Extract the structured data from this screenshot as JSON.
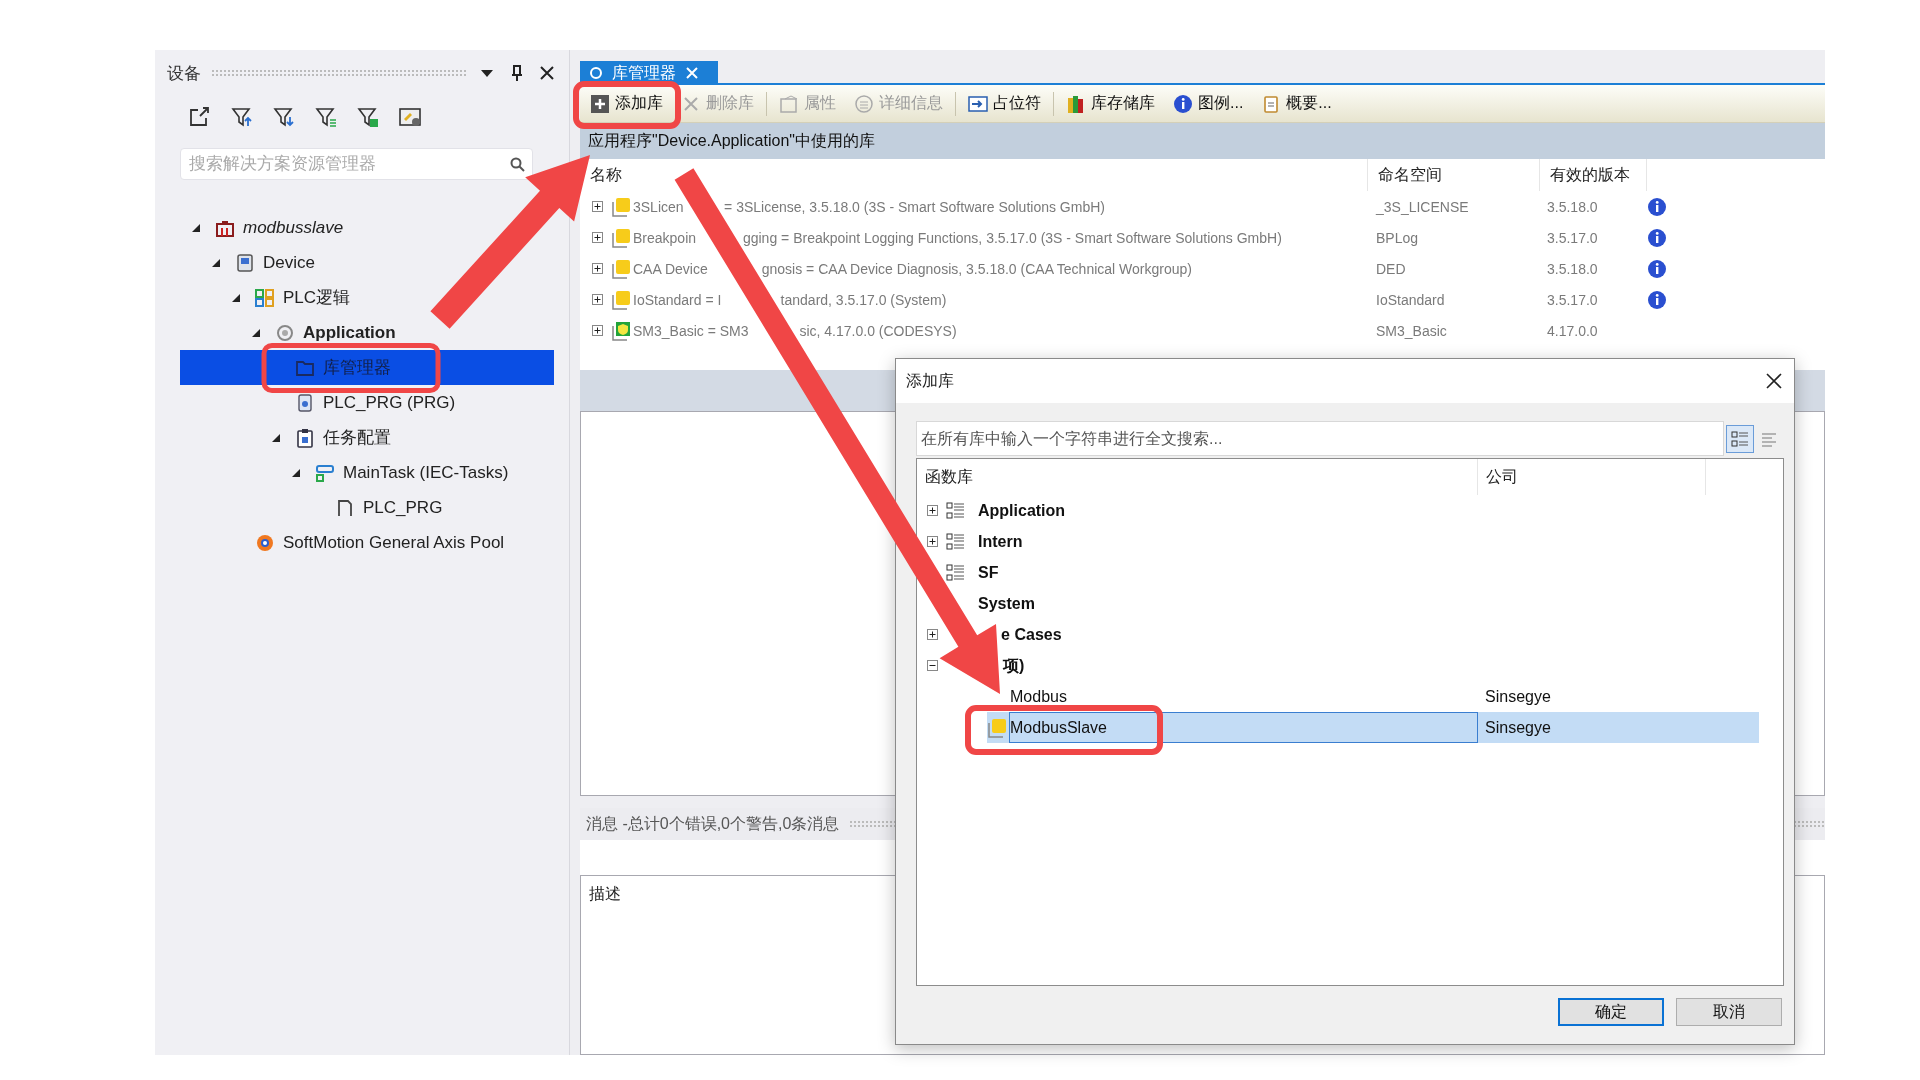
{
  "devices_panel": {
    "title": "设备",
    "search": {
      "placeholder": "搜索解决方案资源管理器"
    },
    "tree": [
      {
        "label": "modbusslave",
        "kind": "project",
        "expanded": true,
        "selected": false,
        "children": [
          {
            "label": "Device",
            "kind": "device",
            "expanded": true,
            "selected": false,
            "children": [
              {
                "label": "PLC逻辑",
                "kind": "plc-logic",
                "expanded": true,
                "selected": false,
                "children": [
                  {
                    "label": "Application",
                    "kind": "application",
                    "expanded": true,
                    "selected": false,
                    "active": true,
                    "children": [
                      {
                        "label": "库管理器",
                        "kind": "library-manager",
                        "selected": true
                      },
                      {
                        "label": "PLC_PRG (PRG)",
                        "kind": "pou",
                        "selected": false
                      },
                      {
                        "label": "任务配置",
                        "kind": "task-config",
                        "expanded": true,
                        "selected": false,
                        "children": [
                          {
                            "label": "MainTask (IEC-Tasks)",
                            "kind": "task",
                            "expanded": true,
                            "selected": false,
                            "children": [
                              {
                                "label": "PLC_PRG",
                                "kind": "program-call",
                                "selected": false
                              }
                            ]
                          }
                        ]
                      }
                    ]
                  }
                ]
              },
              {
                "label": "SoftMotion General Axis Pool",
                "kind": "axis-pool",
                "selected": false
              }
            ]
          }
        ]
      }
    ]
  },
  "editor": {
    "tab": {
      "label": "库管理器",
      "selected": true
    },
    "toolbar": [
      {
        "label": "添加库",
        "kind": "add",
        "disabled": false,
        "group_start": false
      },
      {
        "label": "删除库",
        "kind": "delete",
        "disabled": true,
        "group_start": false
      },
      {
        "label": "属性",
        "kind": "properties",
        "disabled": true,
        "group_start": true
      },
      {
        "label": "详细信息",
        "kind": "details",
        "disabled": true,
        "group_start": false
      },
      {
        "label": "占位符",
        "kind": "placeholder",
        "disabled": false,
        "group_start": true
      },
      {
        "label": "库存储库",
        "kind": "repository",
        "disabled": false,
        "group_start": true
      },
      {
        "label": "图例...",
        "kind": "info",
        "disabled": false,
        "group_start": false
      },
      {
        "label": "概要...",
        "kind": "summary",
        "disabled": false,
        "group_start": false
      }
    ],
    "heading": "应用程序\"Device.Application\"中使用的库",
    "table": {
      "columns": [
        "名称",
        "命名空间",
        "有效的版本"
      ],
      "rows": [
        {
          "name_parts": [
            "3SLicen",
            "= 3SLicense, 3.5.18.0 (3S - Smart Software Solutions GmbH)"
          ],
          "namespace": "_3S_LICENSE",
          "version": "3.5.18.0",
          "kind": "library",
          "info": true
        },
        {
          "name_parts": [
            "Breakpoin",
            "gging = Breakpoint Logging Functions, 3.5.17.0 (3S - Smart Software Solutions GmbH)"
          ],
          "namespace": "BPLog",
          "version": "3.5.17.0",
          "kind": "library",
          "info": true
        },
        {
          "name_parts": [
            "CAA Device",
            "gnosis = CAA Device Diagnosis, 3.5.18.0 (CAA Technical Workgroup)"
          ],
          "namespace": "DED",
          "version": "3.5.18.0",
          "kind": "library",
          "info": true
        },
        {
          "name_parts": [
            "IoStandard = I",
            "tandard, 3.5.17.0 (System)"
          ],
          "namespace": "IoStandard",
          "version": "3.5.17.0",
          "kind": "library",
          "info": true
        },
        {
          "name_parts": [
            "SM3_Basic = SM3",
            "sic, 4.17.0.0 (CODESYS)"
          ],
          "namespace": "SM3_Basic",
          "version": "4.17.0.0",
          "kind": "verified",
          "info": false
        }
      ]
    },
    "messages": {
      "title": "消息 -总计0个错误,0个警告,0条消息",
      "column": "描述"
    }
  },
  "dialog": {
    "title": "添加库",
    "search": {
      "placeholder": "在所有库中输入一个字符串进行全文搜索..."
    },
    "columns": [
      "函数库",
      "公司"
    ],
    "tree": [
      {
        "label": "Application",
        "expanded": false
      },
      {
        "label": "Intern",
        "expanded": false
      },
      {
        "label": "SF"
      },
      {
        "label": "System"
      },
      {
        "label": "e Cases",
        "expanded": false
      },
      {
        "label": "项)",
        "expanded": true,
        "children": [
          {
            "label": "Modbus",
            "company": "Sinsegye",
            "selected": false
          },
          {
            "label": "ModbusSlave",
            "company": "Sinsegye",
            "selected": true
          }
        ]
      }
    ],
    "buttons": [
      {
        "label": "确定",
        "default": true
      },
      {
        "label": "取消",
        "default": false
      }
    ]
  }
}
